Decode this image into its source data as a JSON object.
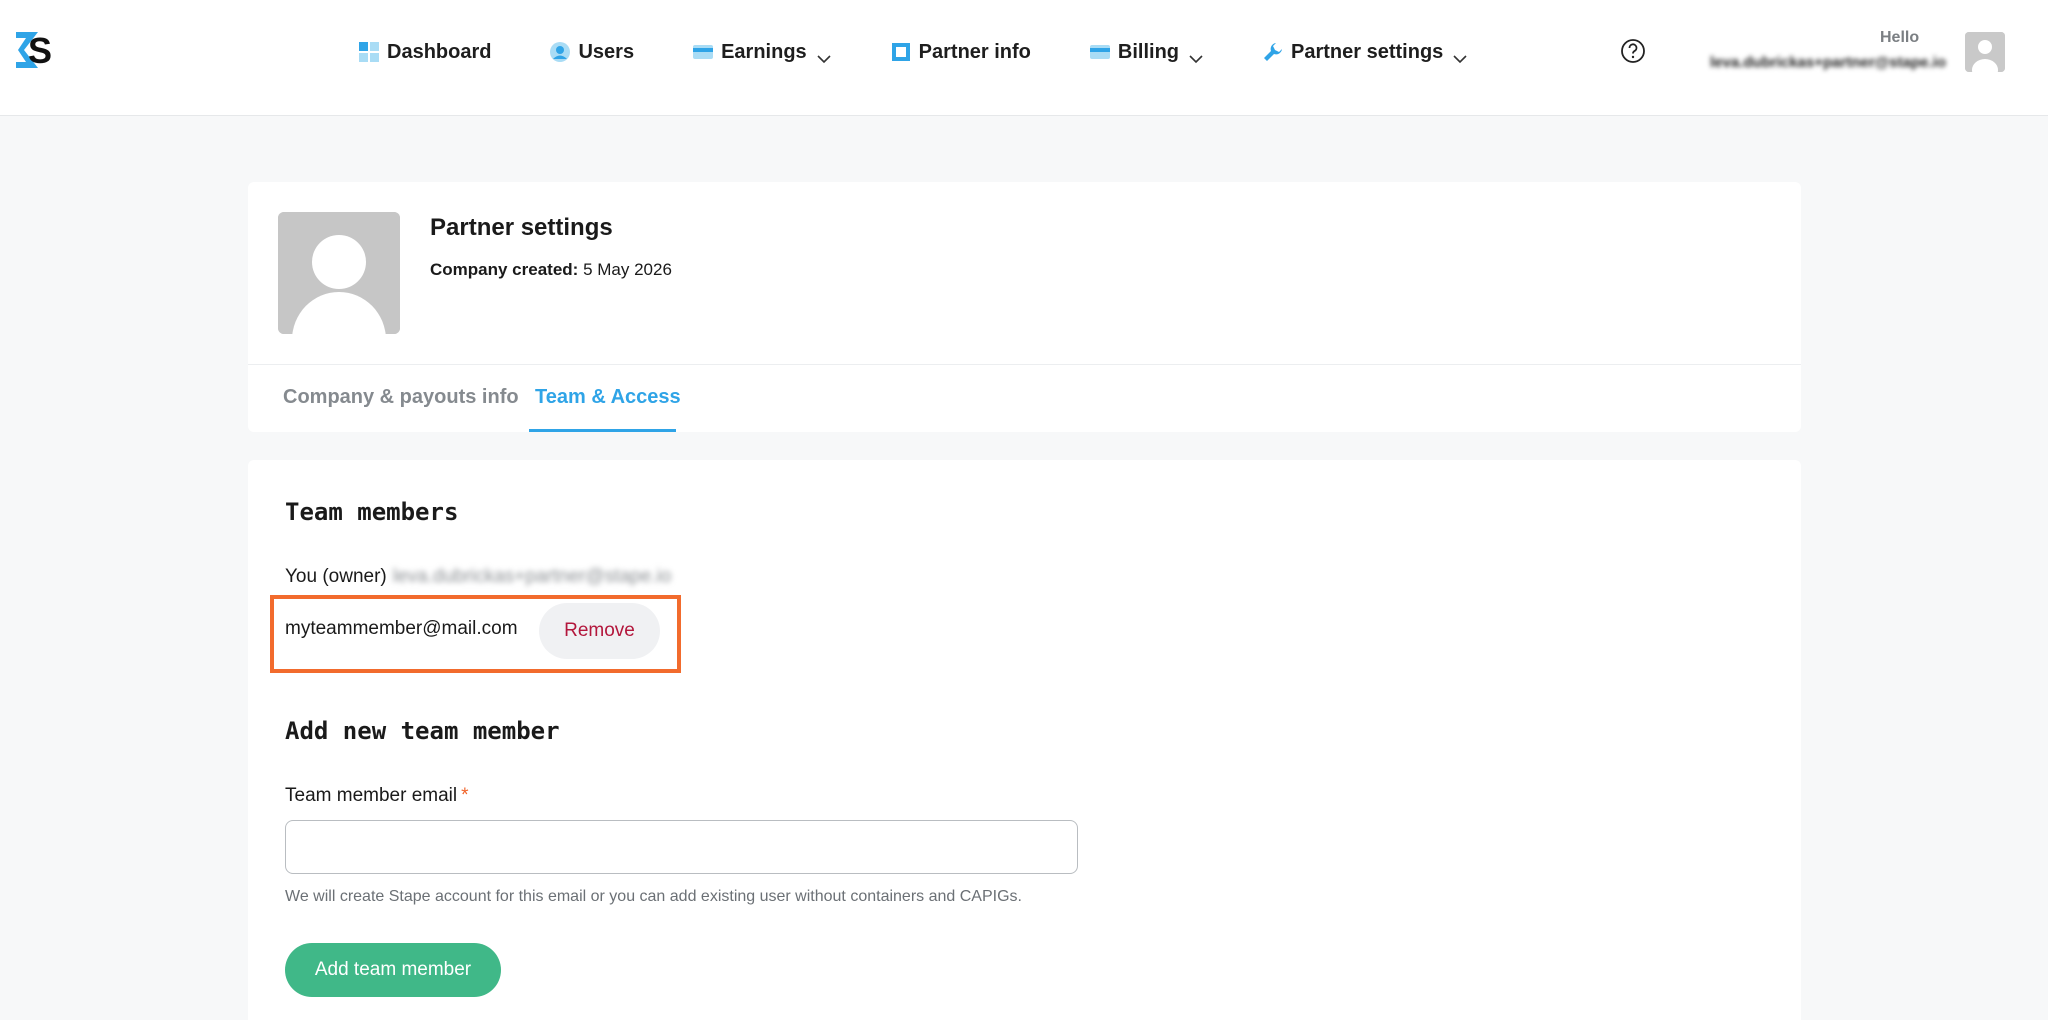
{
  "brand": {
    "logo_letter": "S"
  },
  "nav": {
    "items": [
      {
        "label": "Dashboard",
        "icon": "dashboard-icon",
        "dropdown": false
      },
      {
        "label": "Users",
        "icon": "users-icon",
        "dropdown": false
      },
      {
        "label": "Earnings",
        "icon": "card-icon",
        "dropdown": true
      },
      {
        "label": "Partner info",
        "icon": "square-icon",
        "dropdown": false
      },
      {
        "label": "Billing",
        "icon": "card-icon",
        "dropdown": true
      },
      {
        "label": "Partner settings",
        "icon": "wrench-icon",
        "dropdown": true
      }
    ]
  },
  "user": {
    "greeting": "Hello",
    "email": "leva.dubrickas+partner@stape.io"
  },
  "profile": {
    "title": "Partner settings",
    "company_created_label": "Company created:",
    "company_created_value": "5 May 2026"
  },
  "tabs": [
    {
      "label": "Company & payouts info",
      "active": false
    },
    {
      "label": "Team & Access",
      "active": true
    }
  ],
  "team": {
    "members_title": "Team members",
    "owner_label": "You (owner)",
    "owner_email": "leva.dubrickas+partner@stape.io",
    "members": [
      {
        "email": "myteammember@mail.com",
        "remove_label": "Remove"
      }
    ],
    "add_title": "Add new team member",
    "email_label": "Team member email",
    "required_mark": "*",
    "email_value": "",
    "hint": "We will create Stape account for this email or you can add existing user without containers and CAPIGs.",
    "add_button": "Add team member"
  },
  "colors": {
    "accent_blue": "#2fa4e7",
    "add_green": "#40b888",
    "remove_red": "#b3173c",
    "highlight_orange": "#f26b2d"
  }
}
